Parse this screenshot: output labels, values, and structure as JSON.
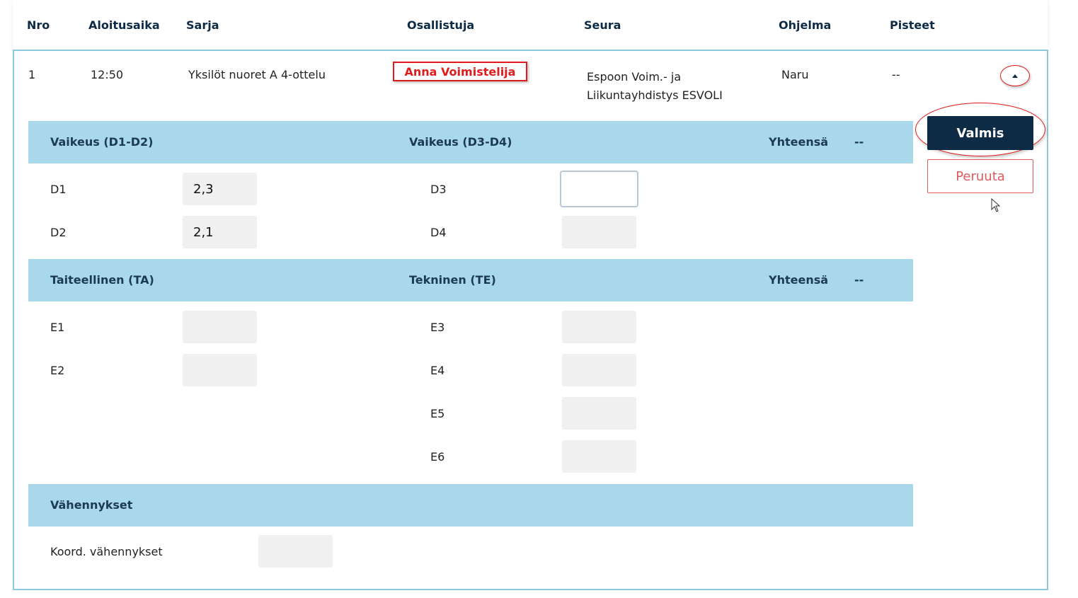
{
  "table": {
    "headers": [
      "Nro",
      "Aloitusaika",
      "Sarja",
      "Osallistuja",
      "Seura",
      "Ohjelma",
      "Pisteet"
    ]
  },
  "row": {
    "nro": "1",
    "start_time": "12:50",
    "series": "Yksilöt nuoret A 4-ottelu",
    "participant": "Anna Voimistelija",
    "club_line1": "Espoon Voim.- ja",
    "club_line2": "Liikuntayhdistys ESVOLI",
    "program": "Naru",
    "points": "--"
  },
  "difficulty": {
    "left_title": "Vaikeus (D1-D2)",
    "right_title": "Vaikeus (D3-D4)",
    "total_label": "Yhteensä",
    "total_value": "--",
    "fields": {
      "d1": {
        "label": "D1",
        "value": "2,3"
      },
      "d2": {
        "label": "D2",
        "value": "2,1"
      },
      "d3": {
        "label": "D3",
        "value": ""
      },
      "d4": {
        "label": "D4",
        "value": ""
      }
    }
  },
  "execution": {
    "left_title": "Taiteellinen (TA)",
    "right_title": "Tekninen (TE)",
    "total_label": "Yhteensä",
    "total_value": "--",
    "fields": {
      "e1": {
        "label": "E1",
        "value": ""
      },
      "e2": {
        "label": "E2",
        "value": ""
      },
      "e3": {
        "label": "E3",
        "value": ""
      },
      "e4": {
        "label": "E4",
        "value": ""
      },
      "e5": {
        "label": "E5",
        "value": ""
      },
      "e6": {
        "label": "E6",
        "value": ""
      }
    }
  },
  "deductions": {
    "title": "Vähennykset",
    "coord_label": "Koord. vähennykset",
    "coord_value": ""
  },
  "actions": {
    "done_label": "Valmis",
    "cancel_label": "Peruuta"
  },
  "colors": {
    "band": "#a8d8ea",
    "primary": "#0d2b45",
    "cancel": "#e05a5a",
    "annotation": "#e01b1b"
  }
}
